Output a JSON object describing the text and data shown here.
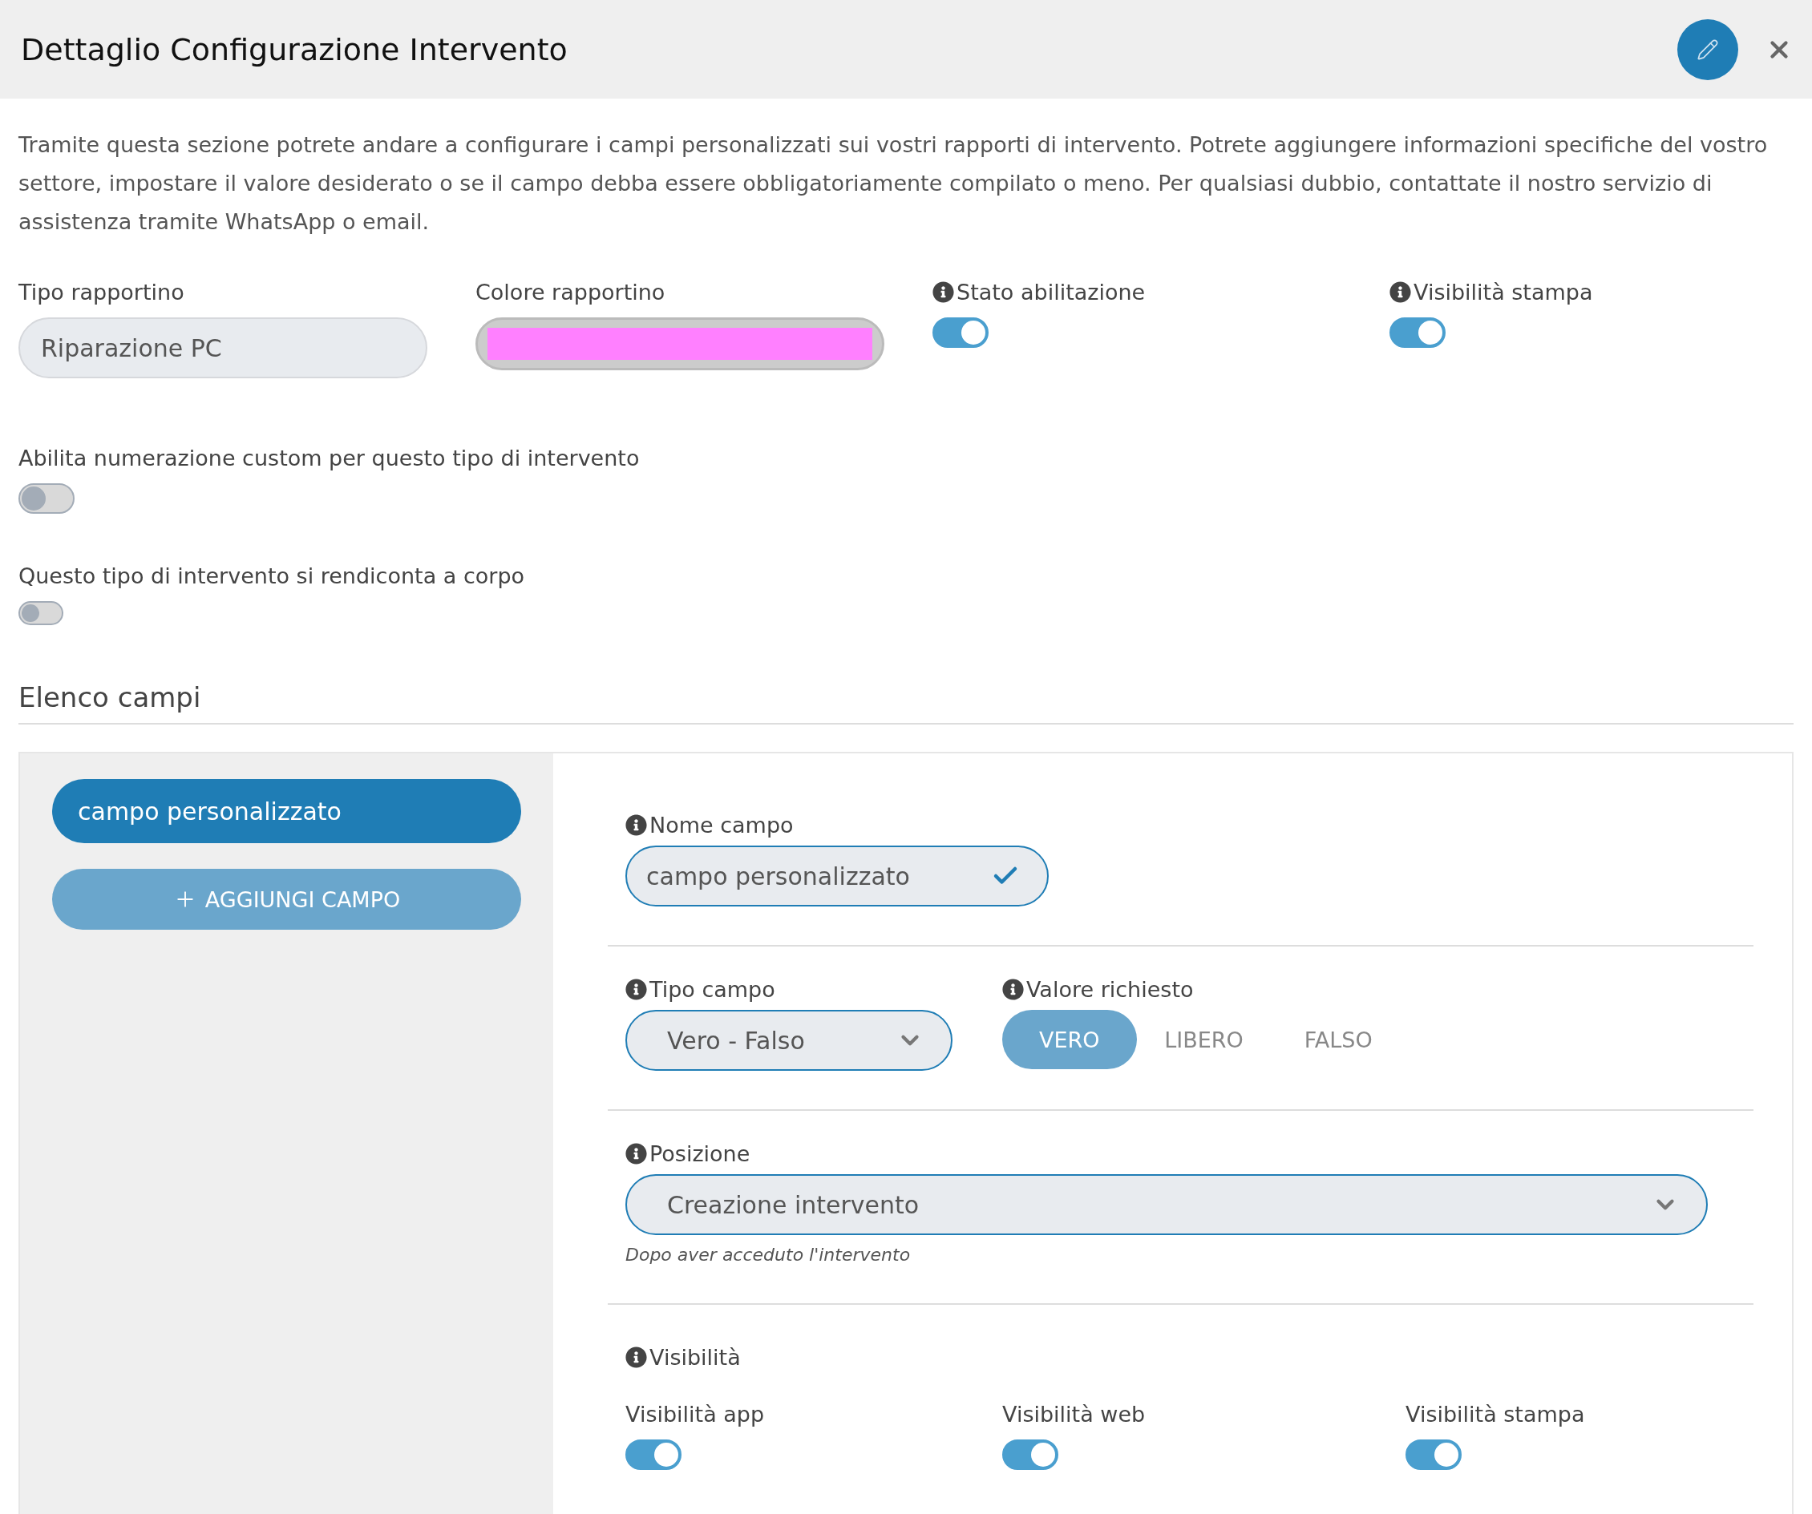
{
  "header": {
    "title": "Dettaglio Configurazione Intervento"
  },
  "intro": "Tramite questa sezione potrete andare a configurare i campi personalizzati sui vostri rapporti di intervento. Potrete aggiungere informazioni specifiche del vostro settore, impostare il valore desiderato o se il campo debba essere obbligatoriamente compilato o meno. Per qualsiasi dubbio, contattate il nostro servizio di assistenza tramite WhatsApp o email.",
  "settings": [
    {
      "kind": "text",
      "label": "Tipo rapportino",
      "value": "Riparazione PC"
    },
    {
      "kind": "color",
      "label": "Colore rapportino",
      "color": "#ff80ff"
    },
    {
      "kind": "toggle",
      "label": "Stato abilitazione",
      "on": true
    },
    {
      "kind": "toggle",
      "label": "Visibilità stampa",
      "on": true
    }
  ],
  "options": [
    {
      "label": "Abilita numerazione custom per questo tipo di intervento",
      "on": false
    },
    {
      "label": "Questo tipo di intervento si rendiconta a corpo",
      "on": false
    }
  ],
  "fields_section": {
    "title": "Elenco campi",
    "fields": [
      {
        "label": "campo personalizzato",
        "selected": true
      }
    ],
    "add_button": "AGGIUNGI CAMPO"
  },
  "editor": {
    "name": {
      "label": "Nome campo",
      "value": "campo personalizzato"
    },
    "type": {
      "label": "Tipo campo",
      "value": "Vero - Falso"
    },
    "required": {
      "label": "Valore richiesto",
      "options": [
        {
          "label": "VERO",
          "selected": true
        },
        {
          "label": "LIBERO",
          "selected": false
        },
        {
          "label": "FALSO",
          "selected": false
        }
      ]
    },
    "position": {
      "label": "Posizione",
      "value": "Creazione intervento",
      "hint": "Dopo aver acceduto l'intervento"
    },
    "visibility": {
      "label": "Visibilità",
      "toggles": [
        {
          "label": "Visibilità app",
          "on": true
        },
        {
          "label": "Visibilità web",
          "on": true
        },
        {
          "label": "Visibilità stampa",
          "on": true
        }
      ]
    }
  }
}
